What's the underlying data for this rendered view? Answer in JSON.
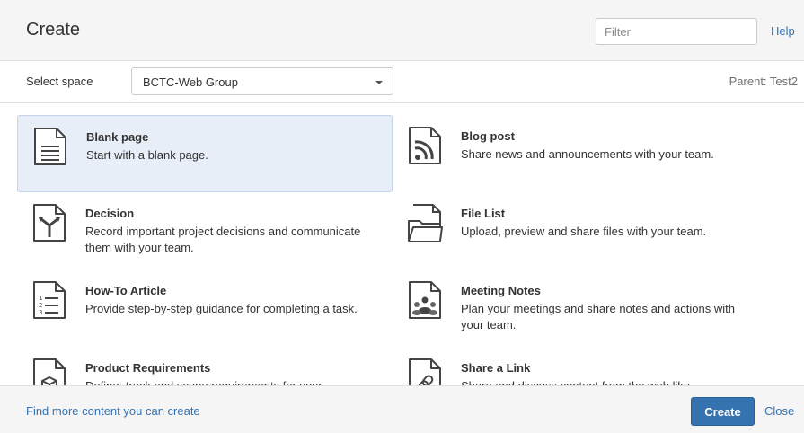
{
  "dialog": {
    "title": "Create"
  },
  "header": {
    "filter_placeholder": "Filter",
    "help_label": "Help"
  },
  "space": {
    "label": "Select space",
    "selected": "BCTC-Web Group",
    "parent": "Parent: Test2"
  },
  "templates": [
    {
      "name": "Blank page",
      "description": "Start with a blank page.",
      "icon": "blank-page-icon",
      "selected": true
    },
    {
      "name": "Blog post",
      "description": "Share news and announcements with your team.",
      "icon": "blog-post-icon",
      "selected": false
    },
    {
      "name": "Decision",
      "description": "Record important project decisions and communicate them with your team.",
      "icon": "decision-icon",
      "selected": false
    },
    {
      "name": "File List",
      "description": "Upload, preview and share files with your team.",
      "icon": "file-list-icon",
      "selected": false
    },
    {
      "name": "How-To Article",
      "description": "Provide step-by-step guidance for completing a task.",
      "icon": "how-to-article-icon",
      "selected": false
    },
    {
      "name": "Meeting Notes",
      "description": "Plan your meetings and share notes and actions with your team.",
      "icon": "meeting-notes-icon",
      "selected": false
    },
    {
      "name": "Product Requirements",
      "description": "Define, track and scope requirements for your",
      "icon": "product-requirements-icon",
      "selected": false
    },
    {
      "name": "Share a Link",
      "description": "Share and discuss content from the web like",
      "icon": "share-link-icon",
      "selected": false
    }
  ],
  "footer": {
    "more_link": "Find more content you can create",
    "create_label": "Create",
    "close_label": "Close"
  },
  "colors": {
    "accent": "#3572b0",
    "selected_bg": "#e8eef7",
    "header_bg": "#f5f5f5"
  }
}
